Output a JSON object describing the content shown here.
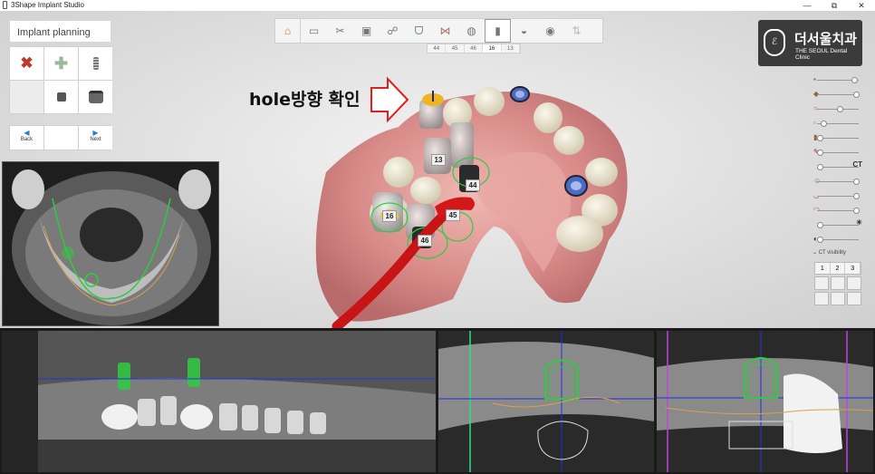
{
  "window": {
    "title": "3Shape Implant Studio",
    "minimize": "—",
    "restore": "⧉",
    "close": "✕"
  },
  "plan_panel": {
    "title": "Implant planning",
    "back_label": "Back",
    "next_label": "Next",
    "tools": [
      "delete-icon",
      "add-icon",
      "implant-icon",
      "",
      "abutment-icon",
      "sleeve-icon"
    ]
  },
  "workflow": {
    "steps": [
      "home-icon",
      "scan-icon",
      "tools-icon",
      "ct-icon",
      "nerve-icon",
      "crown-icon",
      "scan-align-icon",
      "tooth-icon",
      "implant-icon",
      "sleeve-icon",
      "guide-icon",
      "export-icon"
    ]
  },
  "tooth_tabs": [
    "44",
    "45",
    "46",
    "16",
    "13"
  ],
  "logo": {
    "korean": "더서울치과",
    "english": "THE SEOUL Dental Clinic"
  },
  "annotation": {
    "text": "hole방향 확인"
  },
  "implants": {
    "labels": [
      "13",
      "16",
      "44",
      "45",
      "46"
    ]
  },
  "right_panel": {
    "ct_label": "CT",
    "ct_visibility": "CT visibility",
    "ct_tabs": [
      "1",
      "2",
      "3"
    ]
  },
  "colors": {
    "gum": "#d98c8a",
    "tooth": "#e8e2cf",
    "implant_green": "#2ecc40",
    "drill_red": "#c81414",
    "arrow_red": "#e02020",
    "nav_blue": "#2a7fd4",
    "logo_bg": "#3b3b3b"
  }
}
